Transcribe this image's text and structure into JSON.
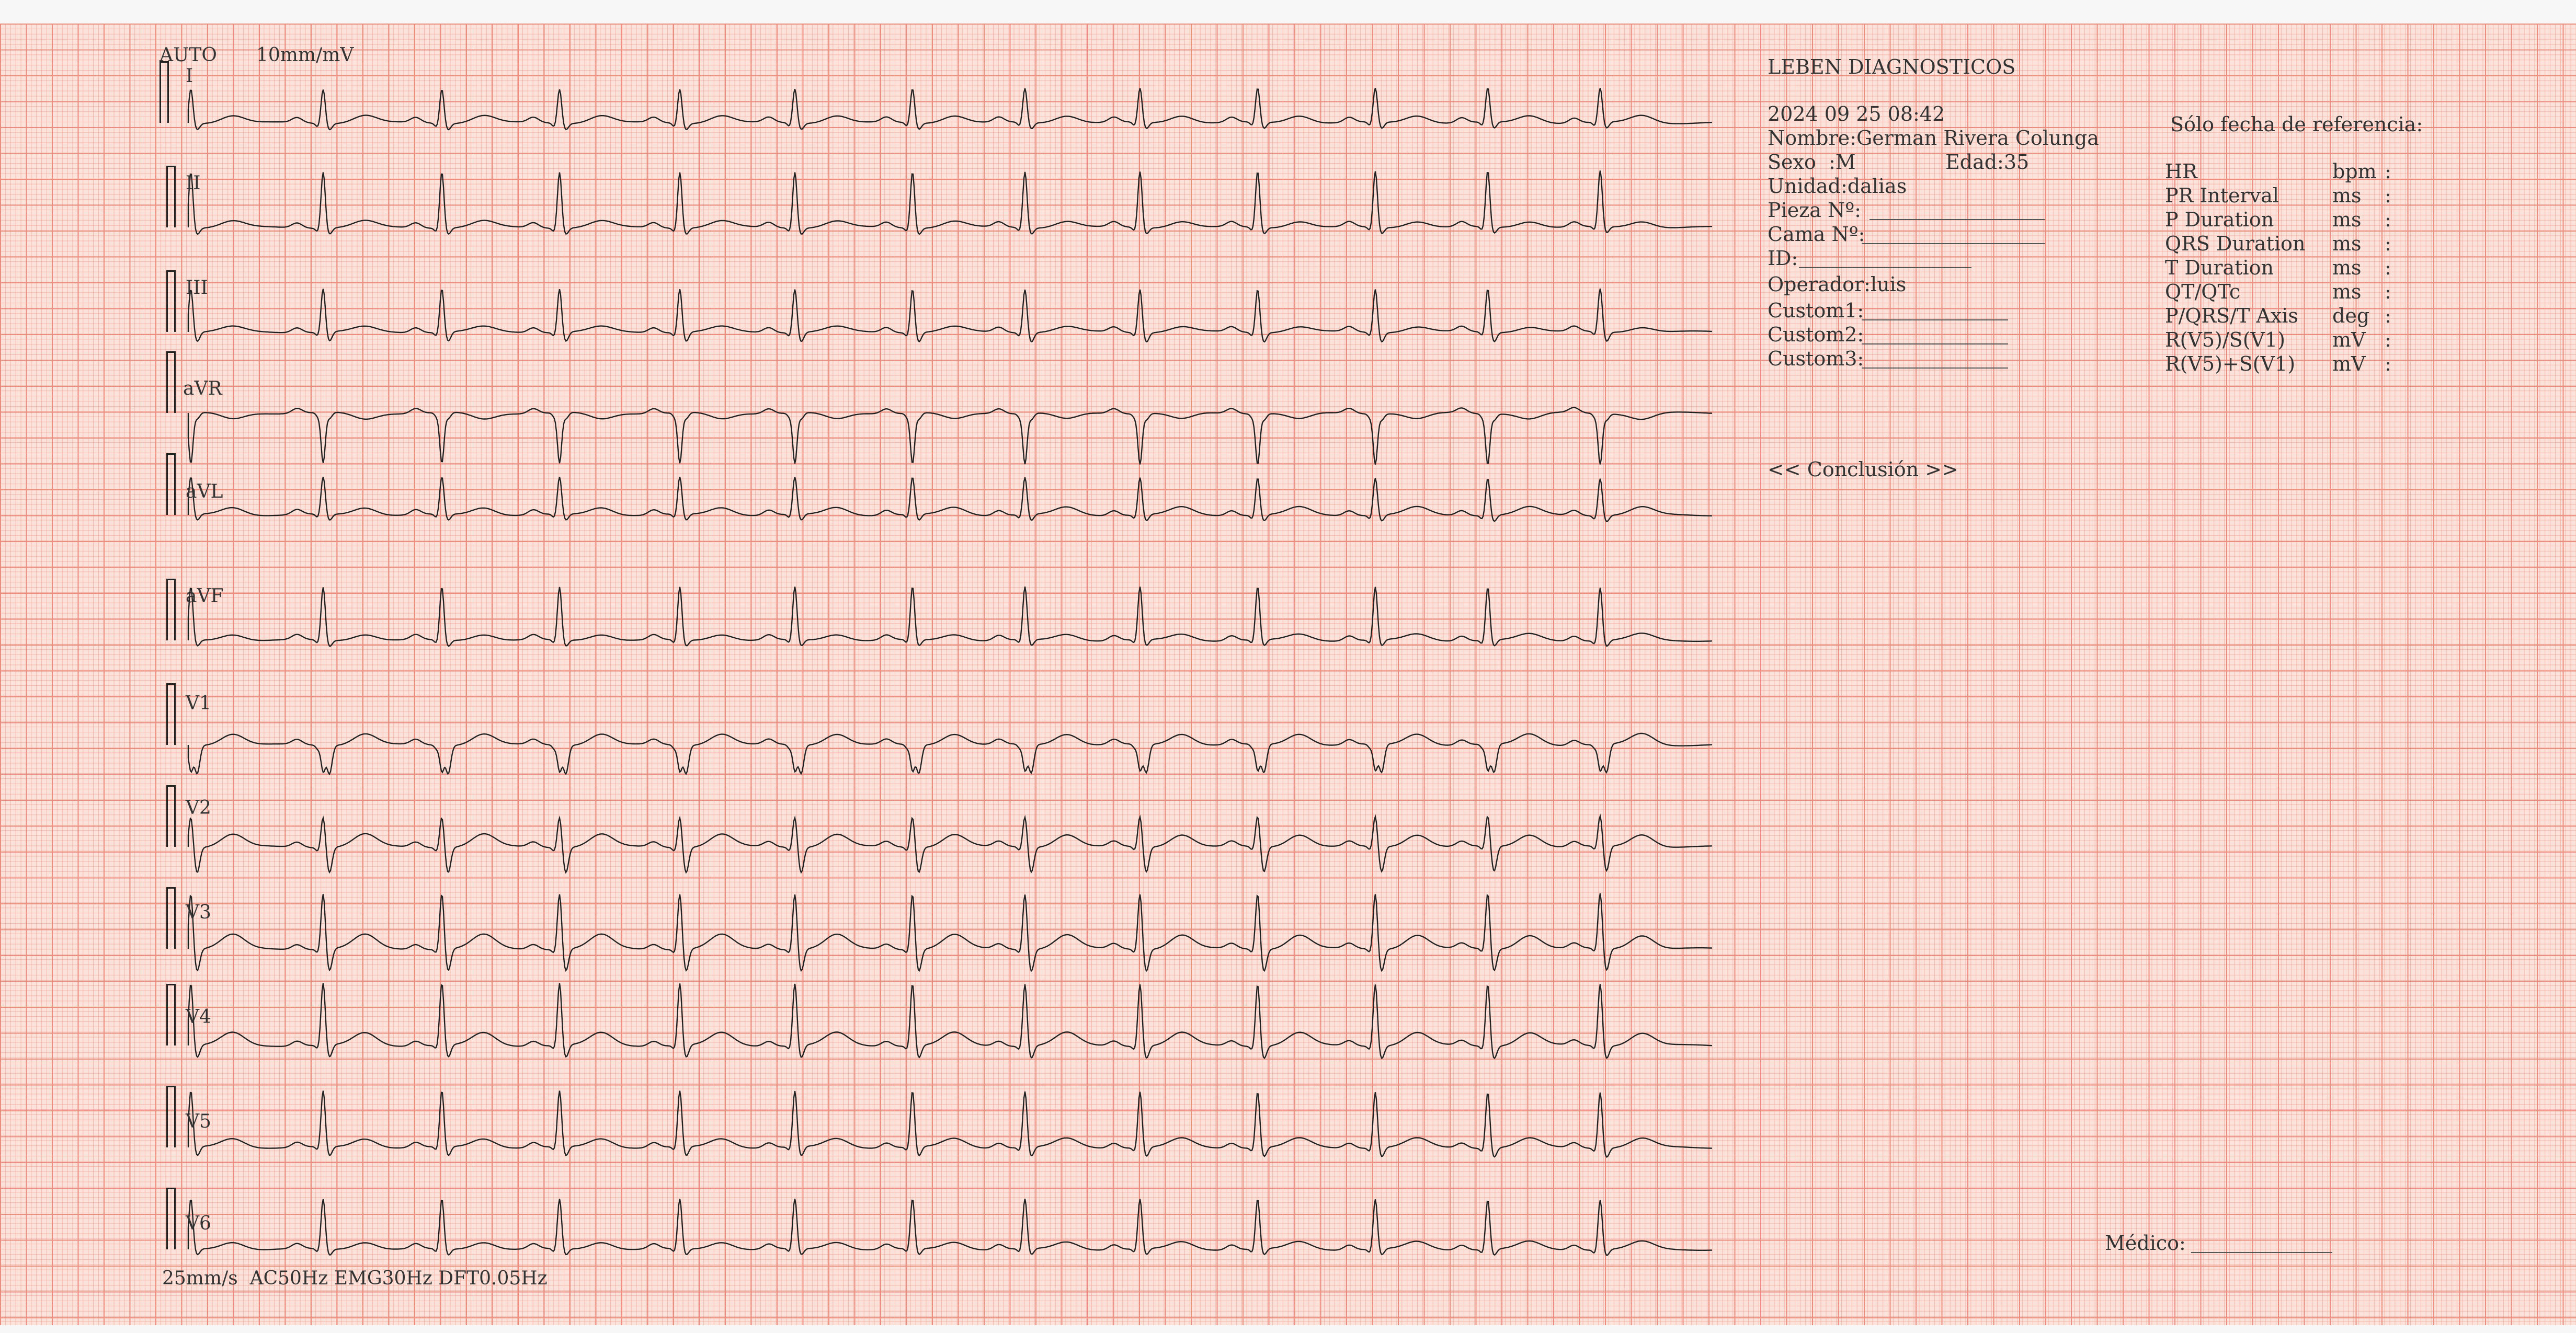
{
  "header": {
    "mode": "AUTO",
    "gain": "10mm/mV"
  },
  "leads": [
    "I",
    "II",
    "III",
    "aVR",
    "aVL",
    "aVF",
    "V1",
    "V2",
    "V3",
    "V4",
    "V5",
    "V6"
  ],
  "footer": {
    "filters": "25mm/s  AC50Hz EMG30Hz DFT0.05Hz"
  },
  "patient": {
    "clinic": "LEBEN DIAGNOSTICOS",
    "datetime": "2024 09 25 08:42",
    "nombre": "Nombre:German Rivera Colunga",
    "sexo": "Sexo  :M",
    "edad": "Edad:35",
    "unidad": "Unidad:dalias",
    "pieza": "Pieza Nº:",
    "cama": "Cama Nº:",
    "id": "ID:",
    "operador": "Operador:luis",
    "custom1": "Custom1:",
    "custom2": "Custom2:",
    "custom3": "Custom3:"
  },
  "conclusion": "<< Conclusión >>",
  "measurements": {
    "title": "Sólo fecha de referencia:",
    "rows": [
      {
        "label": "HR",
        "unit": "bpm"
      },
      {
        "label": "PR Interval",
        "unit": "ms"
      },
      {
        "label": "P Duration",
        "unit": "ms"
      },
      {
        "label": "QRS Duration",
        "unit": "ms"
      },
      {
        "label": "T Duration",
        "unit": "ms"
      },
      {
        "label": "QT/QTc",
        "unit": "ms"
      },
      {
        "label": "P/QRS/T Axis",
        "unit": "deg"
      },
      {
        "label": "R(V5)/S(V1)",
        "unit": "mV"
      },
      {
        "label": "R(V5)+S(V1)",
        "unit": "mV"
      }
    ]
  },
  "medico": "Médico:",
  "colors": {
    "paper": "#fbe2da",
    "grid_major": "#ea8f80",
    "grid_minor": "#ee9687",
    "trace": "#222222"
  }
}
